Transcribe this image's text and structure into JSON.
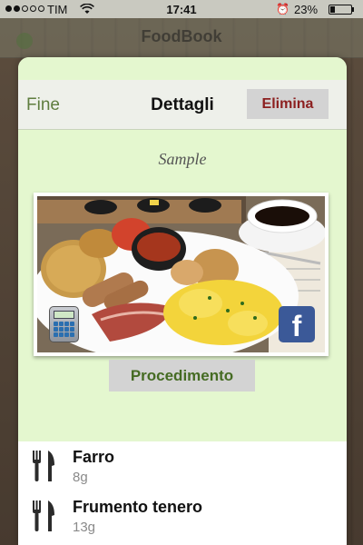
{
  "status_bar": {
    "carrier": "TIM",
    "time": "17:41",
    "battery": "23%",
    "battery_level": 0.23,
    "alarm_icon": "alarm-clock-icon",
    "wifi_icon": "wifi-icon"
  },
  "background_app": {
    "title": "FoodBook"
  },
  "nav": {
    "done_label": "Fine",
    "title": "Dettagli",
    "delete_label": "Elimina"
  },
  "recipe": {
    "name": "Sample",
    "photo_alt": "Breakfast plate with eggs, bacon, beans and coffee",
    "calculator_icon": "calculator-icon",
    "share_icon": "facebook-icon",
    "procedure_label": "Procedimento"
  },
  "ingredients": [
    {
      "name": "Farro",
      "quantity": "8g",
      "icon": "fork-knife-icon"
    },
    {
      "name": "Frumento tenero",
      "quantity": "13g",
      "icon": "fork-knife-icon"
    }
  ],
  "colors": {
    "accent_green": "#5f7d3e",
    "delete_red": "#8c1f1f",
    "sheet_bg": "#e4f7cf",
    "facebook_blue": "#3b5998"
  }
}
